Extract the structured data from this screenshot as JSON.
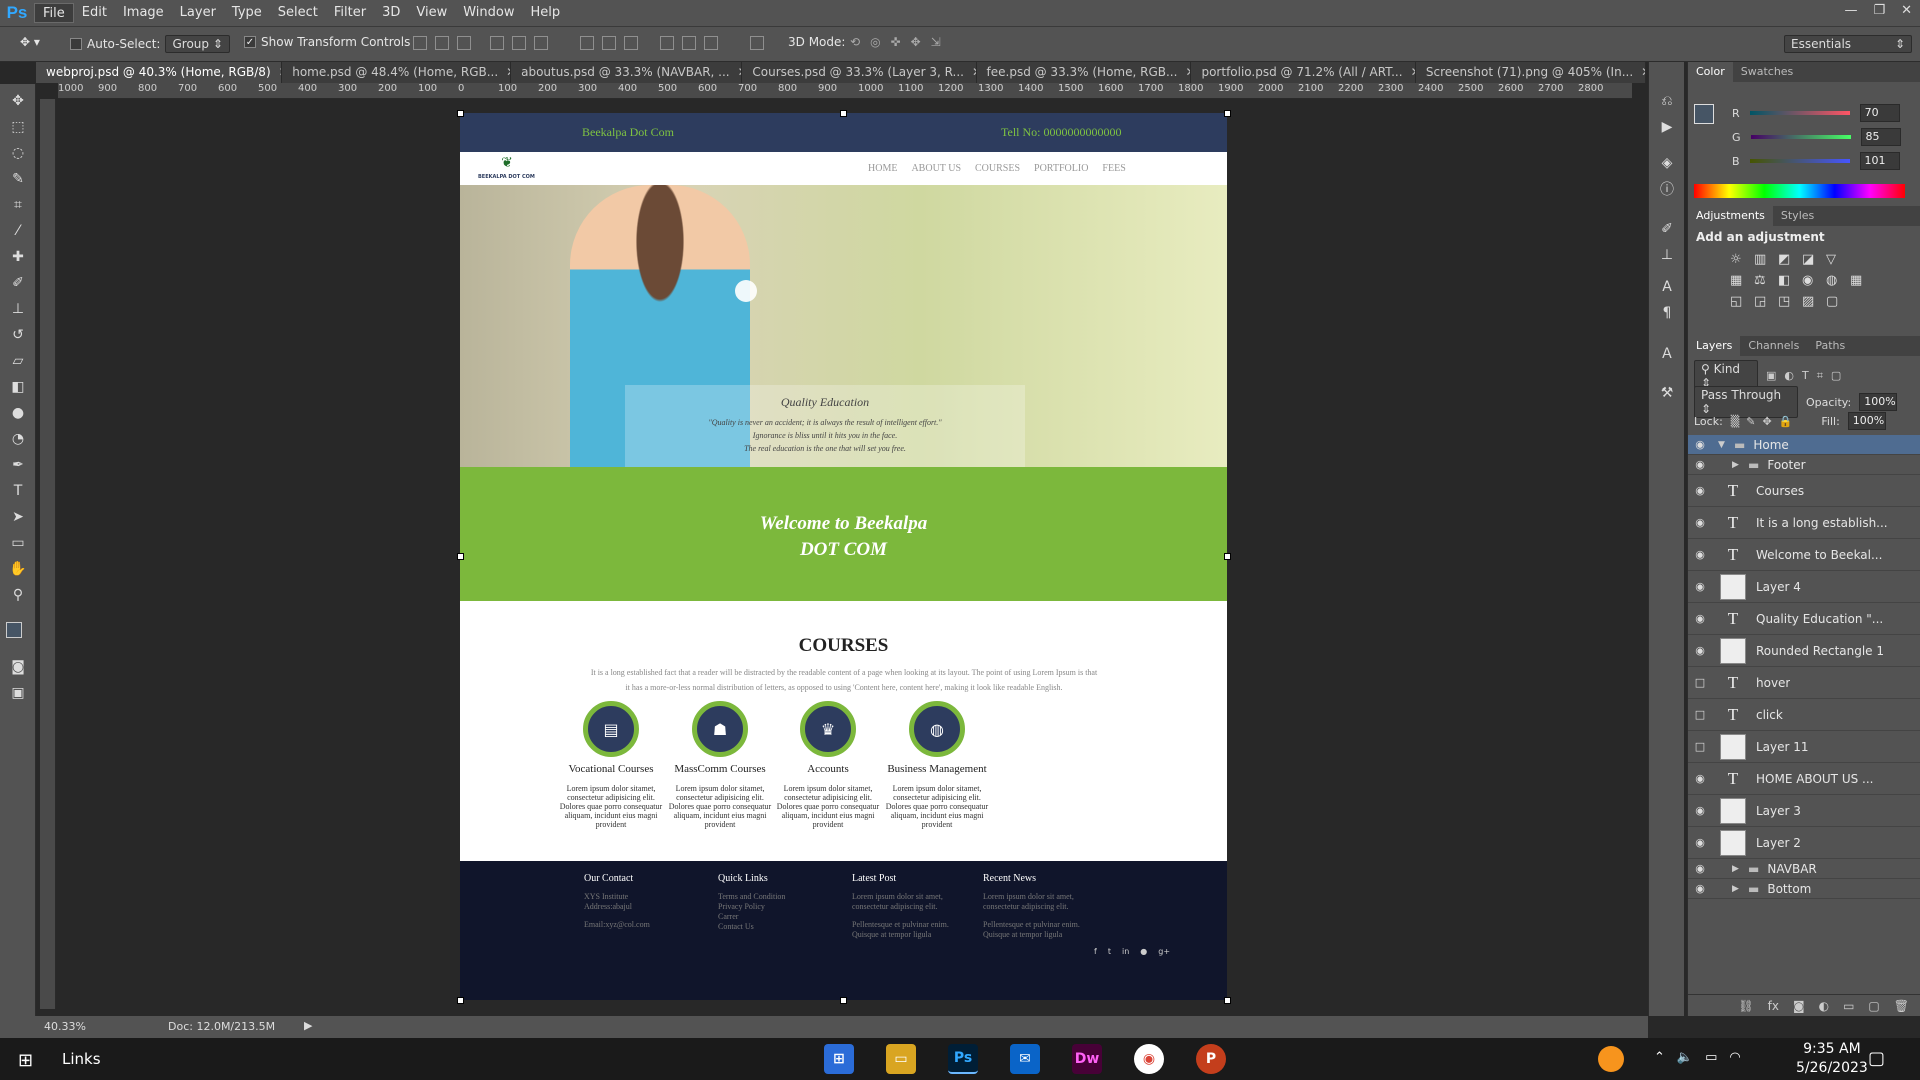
{
  "app": {
    "logo": "Ps"
  },
  "menu": [
    "File",
    "Edit",
    "Image",
    "Layer",
    "Type",
    "Select",
    "Filter",
    "3D",
    "View",
    "Window",
    "Help"
  ],
  "options_bar": {
    "auto_select_label": "Auto-Select:",
    "auto_select_value": "Group",
    "show_transform_label": "Show Transform Controls",
    "mode_3d_label": "3D Mode:",
    "workspace": "Essentials"
  },
  "doc_tabs": [
    {
      "label": "webproj.psd @ 40.3% (Home, RGB/8)",
      "active": true
    },
    {
      "label": "home.psd @ 48.4% (Home, RGB...",
      "active": false
    },
    {
      "label": "aboutus.psd @ 33.3% (NAVBAR, ...",
      "active": false
    },
    {
      "label": "Courses.psd @ 33.3% (Layer 3, R...",
      "active": false
    },
    {
      "label": "fee.psd @ 33.3% (Home, RGB...",
      "active": false
    },
    {
      "label": "portfolio.psd @ 71.2% (All / ART...",
      "active": false
    },
    {
      "label": "Screenshot (71).png @ 405% (In...",
      "active": false
    }
  ],
  "ruler_ticks": [
    "1000",
    "900",
    "800",
    "700",
    "600",
    "500",
    "400",
    "300",
    "200",
    "100",
    "0",
    "100",
    "200",
    "300",
    "400",
    "500",
    "600",
    "700",
    "800",
    "900",
    "1000",
    "1100",
    "1200",
    "1300",
    "1400",
    "1500",
    "1600",
    "1700",
    "1800",
    "1900",
    "2000",
    "2100",
    "2200",
    "2300",
    "2400",
    "2500",
    "2600",
    "2700",
    "2800"
  ],
  "page": {
    "brand": "Beekalpa Dot Com",
    "phone": "Tell No: 0000000000000",
    "logo_text": "BEEKALPA DOT COM",
    "nav": [
      "HOME",
      "ABOUT US",
      "COURSES",
      "PORTFOLIO",
      "FEES"
    ],
    "quote_title": "Quality Education",
    "quote_lines": [
      "\"Quality is never an accident; it is always the result of intelligent effort.\"",
      "Ignorance is bliss until it hits you in the face.",
      "The real education is the one that will set you free."
    ],
    "welcome_line1": "Welcome to Beekalpa",
    "welcome_line2": "DOT COM",
    "courses_title": "COURSES",
    "courses_desc": "It is a long established fact that a reader will be distracted by the readable content of a page when looking at its layout. The point of using Lorem Ipsum is that it has a more-or-less normal distribution of letters, as opposed to using 'Content here, content here', making it look like readable English.",
    "courses": [
      {
        "name": "Vocational Courses",
        "icon": "book-icon",
        "glyph": "▤",
        "desc": "Lorem ipsum dolor sitamet, consectetur adipisicing elit. Dolores quae porro consequatur aliquam, incidunt eius magni provident"
      },
      {
        "name": "MassComm Courses",
        "icon": "users-icon",
        "glyph": "☗",
        "desc": "Lorem ipsum dolor sitamet, consectetur adipisicing elit. Dolores quae porro consequatur aliquam, incidunt eius magni provident"
      },
      {
        "name": "Accounts",
        "icon": "trophy-icon",
        "glyph": "♛",
        "desc": "Lorem ipsum dolor sitamet, consectetur adipisicing elit. Dolores quae porro consequatur aliquam, incidunt eius magni provident"
      },
      {
        "name": "Business Management",
        "icon": "globe-icon",
        "glyph": "◍",
        "desc": "Lorem ipsum dolor sitamet, consectetur adipisicing elit. Dolores quae porro consequatur aliquam, incidunt eius magni provident"
      }
    ],
    "footer": {
      "contact_title": "Our Contact",
      "contact": [
        "XYS Institute",
        "Address:abajul",
        "",
        "Email:xyz@col.com"
      ],
      "links_title": "Quick Links",
      "links": [
        "Terms and Condition",
        "Privacy Policy",
        "Carrer",
        "Contact Us"
      ],
      "latest_title": "Latest Post",
      "latest": [
        "Lorem ipsum dolor sit amet,",
        "consectetur adipiscing elit.",
        "",
        "Pellentesque et pulvinar enim.",
        "Quisque at tempor ligula"
      ],
      "news_title": "Recent News",
      "news": [
        "Lorem ipsum dolor sit amet,",
        "consectetur adipiscing elit.",
        "",
        "Pellentesque et pulvinar enim.",
        "Quisque at tempor ligula"
      ],
      "social": [
        "f",
        "t",
        "in",
        "●",
        "g+"
      ]
    }
  },
  "color_panel": {
    "tabs": [
      "Color",
      "Swatches"
    ],
    "r": "70",
    "g": "85",
    "b": "101",
    "labels": [
      "R",
      "G",
      "B"
    ],
    "fg": "#465565"
  },
  "adjustments": {
    "tabs": [
      "Adjustments",
      "Styles"
    ],
    "title": "Add an adjustment"
  },
  "layers_panel": {
    "tabs": [
      "Layers",
      "Channels",
      "Paths"
    ],
    "kind": "Kind",
    "blend": "Pass Through",
    "opacity_label": "Opacity:",
    "opacity": "100%",
    "lock_label": "Lock:",
    "fill_label": "Fill:",
    "fill": "100%",
    "layers": [
      {
        "name": "Home",
        "type": "group",
        "visible": true,
        "selected": true
      },
      {
        "name": "Footer",
        "type": "group",
        "visible": true
      },
      {
        "name": "Courses",
        "type": "text",
        "visible": true
      },
      {
        "name": "It is a long establish...",
        "type": "text",
        "visible": true
      },
      {
        "name": "Welcome to Beekal...",
        "type": "text",
        "visible": true
      },
      {
        "name": "Layer 4",
        "type": "pixel",
        "visible": true
      },
      {
        "name": "Quality Education \"...",
        "type": "text",
        "visible": true
      },
      {
        "name": "Rounded Rectangle 1",
        "type": "pixel",
        "visible": true
      },
      {
        "name": "hover",
        "type": "text",
        "visible": false
      },
      {
        "name": "click",
        "type": "text",
        "visible": false
      },
      {
        "name": "Layer 11",
        "type": "pixel",
        "visible": false
      },
      {
        "name": "HOME  ABOUT US ...",
        "type": "text",
        "visible": true
      },
      {
        "name": "Layer 3",
        "type": "pixel",
        "visible": true
      },
      {
        "name": "Layer 2",
        "type": "pixel",
        "visible": true
      },
      {
        "name": "NAVBAR",
        "type": "group",
        "visible": true
      },
      {
        "name": "Bottom",
        "type": "group",
        "visible": true
      }
    ]
  },
  "status": {
    "zoom": "40.33%",
    "doc": "Doc: 12.0M/213.5M"
  },
  "taskbar": {
    "search": "Links",
    "time": "9:35 AM",
    "date": "5/26/2023"
  }
}
